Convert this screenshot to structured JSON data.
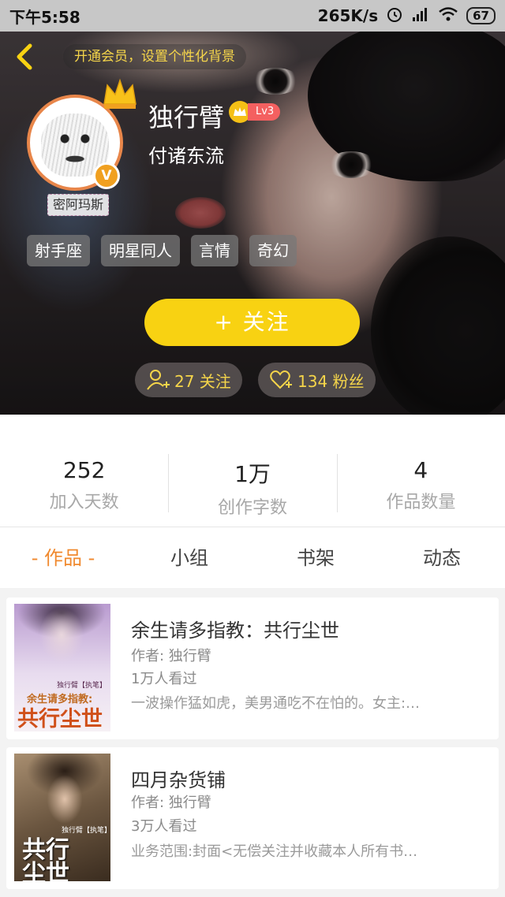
{
  "status_bar": {
    "time": "下午5:58",
    "speed": "265K/s",
    "battery": "67"
  },
  "header": {
    "vip_banner": "开通会员，设置个性化背景"
  },
  "profile": {
    "avatar_label": "密阿玛斯",
    "badge": "V",
    "username": "独行臂",
    "level": "Lv3",
    "signature": "付诸东流",
    "tags": [
      "射手座",
      "明星同人",
      "言情",
      "奇幻"
    ],
    "follow_button": "+  关注",
    "following": "27 关注",
    "followers": "134 粉丝"
  },
  "stats": [
    {
      "value": "252",
      "label": "加入天数"
    },
    {
      "value": "1万",
      "label": "创作字数"
    },
    {
      "value": "4",
      "label": "作品数量"
    }
  ],
  "tabs": [
    {
      "label": "- 作品 -",
      "active": true
    },
    {
      "label": "小组",
      "active": false
    },
    {
      "label": "书架",
      "active": false
    },
    {
      "label": "动态",
      "active": false
    }
  ],
  "works": [
    {
      "title": "余生请多指教：共行尘世",
      "author": "作者: 独行臂",
      "views": "1万人看过",
      "desc": "一波操作猛如虎，美男通吃不在怕的。女主:…",
      "cover_subtitle": "独行臂【执笔】",
      "cover_line": "余生请多指教:",
      "cover_title": "共行尘世"
    },
    {
      "title": "四月杂货铺",
      "author": "作者: 独行臂",
      "views": "3万人看过",
      "desc": "业务范围:封面<无偿关注并收藏本人所有书…",
      "cover_subtitle": "独行臂【执笔】",
      "cover_title": "共行尘世"
    }
  ],
  "colors": {
    "accent": "#f8d212",
    "tab_active": "#f0892e",
    "avatar_ring": "#e8864a"
  }
}
